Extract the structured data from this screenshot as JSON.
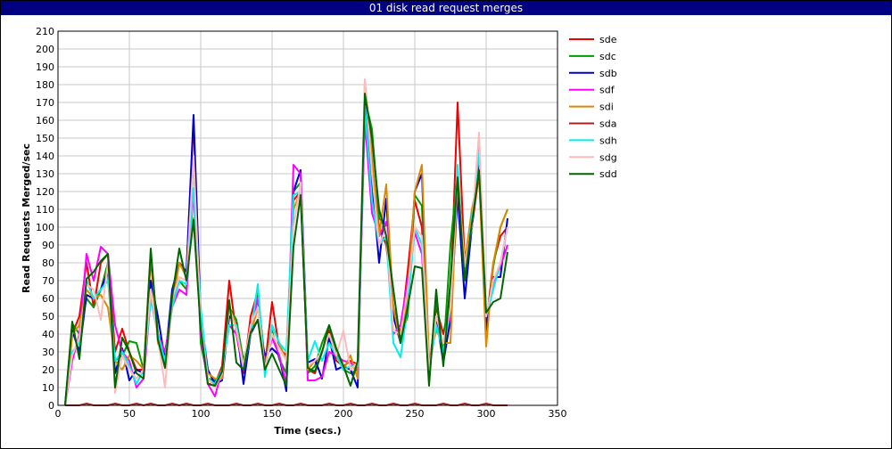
{
  "window": {
    "title": "01 disk read request merges"
  },
  "chart_data": {
    "type": "line",
    "title": "01 disk read request merges",
    "xlabel": "Time (secs.)",
    "ylabel": "Read Requests Merged/sec",
    "xlim": [
      0,
      350
    ],
    "ylim": [
      0,
      210
    ],
    "xticks": [
      0,
      50,
      100,
      150,
      200,
      250,
      300,
      350
    ],
    "yticks": [
      0,
      10,
      20,
      30,
      40,
      50,
      60,
      70,
      80,
      90,
      100,
      110,
      120,
      130,
      140,
      150,
      160,
      170,
      180,
      190,
      200,
      210
    ],
    "grid": true,
    "legend_position": "right",
    "x": [
      5,
      10,
      15,
      20,
      25,
      30,
      35,
      40,
      45,
      50,
      55,
      60,
      65,
      70,
      75,
      80,
      85,
      90,
      95,
      100,
      105,
      110,
      115,
      120,
      125,
      130,
      135,
      140,
      145,
      150,
      155,
      160,
      165,
      170,
      175,
      180,
      185,
      190,
      195,
      200,
      205,
      210,
      215,
      220,
      225,
      230,
      235,
      240,
      245,
      250,
      255,
      260,
      265,
      270,
      275,
      280,
      285,
      290,
      295,
      300,
      305,
      310,
      315
    ],
    "series": [
      {
        "name": "sde",
        "color": "#ee0000",
        "values": [
          0,
          40,
          50,
          80,
          55,
          80,
          85,
          30,
          43,
          30,
          20,
          20,
          82,
          40,
          25,
          60,
          80,
          75,
          160,
          40,
          12,
          12,
          22,
          70,
          40,
          18,
          50,
          64,
          22,
          58,
          32,
          28,
          115,
          120,
          20,
          18,
          30,
          42,
          25,
          22,
          25,
          23,
          165,
          130,
          100,
          90,
          55,
          40,
          75,
          115,
          100,
          20,
          55,
          40,
          60,
          170,
          80,
          100,
          130,
          45,
          80,
          95,
          100
        ]
      },
      {
        "name": "sdc",
        "color": "#009900",
        "values": [
          0,
          46,
          40,
          60,
          55,
          65,
          80,
          25,
          28,
          36,
          35,
          20,
          85,
          40,
          22,
          62,
          70,
          65,
          140,
          35,
          15,
          14,
          18,
          55,
          48,
          25,
          40,
          62,
          25,
          42,
          26,
          18,
          120,
          125,
          18,
          22,
          35,
          45,
          30,
          20,
          18,
          20,
          172,
          155,
          105,
          100,
          50,
          38,
          50,
          118,
          112,
          15,
          60,
          28,
          90,
          130,
          75,
          100,
          140,
          42,
          78,
          100,
          110
        ]
      },
      {
        "name": "sdb",
        "color": "#0000cc",
        "values": [
          0,
          42,
          30,
          62,
          60,
          65,
          75,
          18,
          32,
          14,
          20,
          18,
          70,
          50,
          25,
          65,
          80,
          75,
          163,
          50,
          20,
          12,
          14,
          50,
          46,
          12,
          40,
          48,
          28,
          32,
          28,
          8,
          120,
          132,
          24,
          26,
          15,
          38,
          20,
          22,
          20,
          10,
          176,
          125,
          80,
          116,
          50,
          35,
          55,
          120,
          130,
          20,
          50,
          24,
          48,
          118,
          60,
          100,
          138,
          42,
          72,
          72,
          105
        ]
      },
      {
        "name": "sdf",
        "color": "#ff00ff",
        "values": [
          0,
          25,
          40,
          85,
          70,
          89,
          85,
          45,
          30,
          25,
          10,
          15,
          60,
          40,
          30,
          55,
          65,
          62,
          120,
          40,
          12,
          5,
          20,
          45,
          40,
          20,
          40,
          60,
          22,
          38,
          28,
          12,
          135,
          130,
          14,
          14,
          16,
          30,
          28,
          25,
          24,
          20,
          160,
          108,
          95,
          103,
          40,
          45,
          70,
          97,
          85,
          20,
          45,
          35,
          50,
          125,
          75,
          100,
          147,
          50,
          68,
          78,
          90
        ]
      },
      {
        "name": "sdi",
        "color": "#dd8800",
        "values": [
          0,
          40,
          45,
          65,
          60,
          62,
          55,
          25,
          20,
          28,
          25,
          20,
          85,
          35,
          25,
          55,
          80,
          72,
          105,
          45,
          18,
          15,
          15,
          55,
          45,
          22,
          40,
          55,
          20,
          45,
          35,
          25,
          110,
          120,
          20,
          25,
          30,
          40,
          28,
          20,
          28,
          15,
          182,
          140,
          95,
          124,
          55,
          35,
          60,
          120,
          135,
          25,
          42,
          35,
          35,
          130,
          80,
          110,
          130,
          33,
          80,
          100,
          110
        ]
      },
      {
        "name": "sda",
        "color": "#aa2222",
        "values": [
          0,
          0,
          0,
          1,
          0,
          0,
          0,
          1,
          0,
          0,
          1,
          0,
          1,
          0,
          0,
          1,
          0,
          1,
          0,
          0,
          1,
          0,
          0,
          0,
          1,
          0,
          0,
          1,
          0,
          0,
          1,
          0,
          0,
          1,
          0,
          0,
          0,
          1,
          0,
          0,
          1,
          0,
          0,
          1,
          0,
          0,
          1,
          0,
          0,
          1,
          0,
          0,
          0,
          1,
          0,
          0,
          1,
          0,
          0,
          1,
          0,
          0,
          0
        ]
      },
      {
        "name": "sdh",
        "color": "#00eeee",
        "values": [
          0,
          30,
          35,
          70,
          60,
          65,
          70,
          25,
          30,
          22,
          12,
          20,
          60,
          40,
          25,
          55,
          70,
          68,
          122,
          55,
          15,
          12,
          20,
          45,
          45,
          20,
          40,
          68,
          16,
          45,
          35,
          30,
          118,
          120,
          25,
          36,
          25,
          35,
          28,
          20,
          22,
          22,
          168,
          115,
          90,
          95,
          35,
          27,
          55,
          100,
          90,
          20,
          45,
          30,
          55,
          135,
          70,
          105,
          142,
          50,
          65,
          80,
          100
        ]
      },
      {
        "name": "sdg",
        "color": "#ffbbbb",
        "values": [
          0,
          28,
          38,
          68,
          65,
          48,
          80,
          7,
          28,
          20,
          15,
          20,
          65,
          38,
          10,
          60,
          72,
          70,
          140,
          45,
          15,
          10,
          18,
          55,
          42,
          22,
          45,
          55,
          20,
          40,
          32,
          25,
          100,
          125,
          22,
          25,
          30,
          40,
          28,
          42,
          20,
          24,
          183,
          130,
          90,
          100,
          42,
          40,
          65,
          100,
          95,
          20,
          50,
          35,
          55,
          128,
          78,
          100,
          153,
          50,
          70,
          80,
          100
        ]
      },
      {
        "name": "sdd",
        "color": "#006600",
        "values": [
          0,
          47,
          26,
          71,
          75,
          81,
          85,
          10,
          38,
          30,
          18,
          15,
          88,
          37,
          21,
          61,
          88,
          70,
          104,
          43,
          12,
          11,
          19,
          59,
          24,
          20,
          41,
          48,
          20,
          29,
          20,
          11,
          89,
          118,
          21,
          19,
          30,
          45,
          32,
          22,
          11,
          25,
          175,
          150,
          110,
          95,
          65,
          35,
          55,
          78,
          77,
          11,
          65,
          22,
          70,
          128,
          70,
          102,
          132,
          52,
          58,
          60,
          86
        ]
      }
    ]
  }
}
